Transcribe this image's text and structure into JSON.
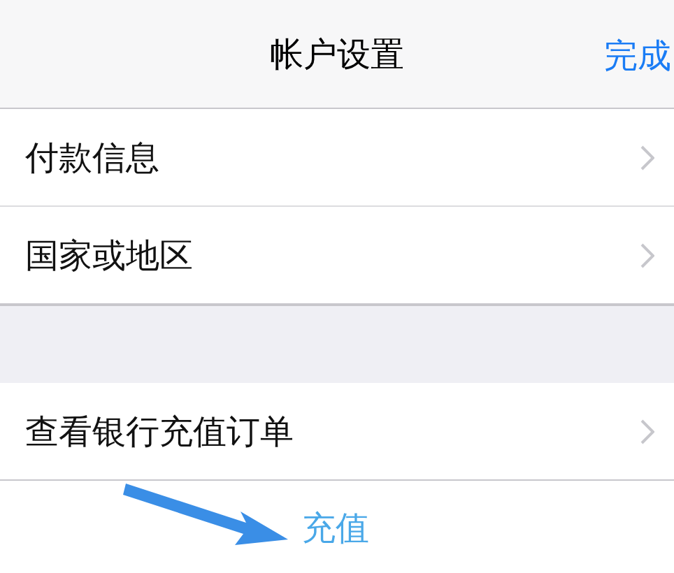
{
  "nav_bar": {
    "title": "帐户设置",
    "done": "完成"
  },
  "groups": [
    {
      "rows": [
        {
          "label": "付款信息"
        },
        {
          "label": "国家或地区"
        }
      ]
    },
    {
      "rows": [
        {
          "label": "查看银行充值订单"
        }
      ]
    }
  ],
  "footer_link": "充值"
}
